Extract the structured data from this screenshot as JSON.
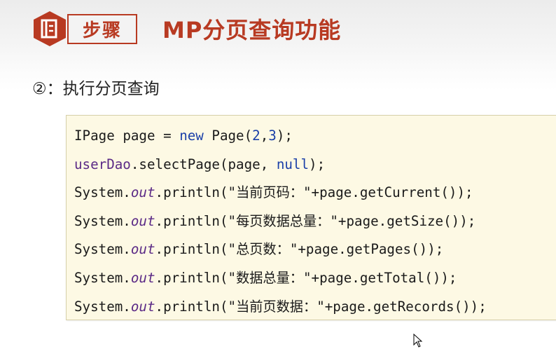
{
  "header": {
    "step_label": "步骤",
    "title": "MP分页查询功能"
  },
  "section": {
    "subtitle": "②：执行分页查询"
  },
  "code": {
    "line1": {
      "type": "IPage",
      "var": " page = ",
      "kw": "new",
      "ctor": " Page(",
      "n1": "2",
      "comma": ",",
      "n2": "3",
      "end": ");"
    },
    "line2": {
      "obj": "userDao",
      "rest": ".selectPage(page, ",
      "kw": "null",
      "end": ");"
    },
    "line3": {
      "sys": "System.",
      "out": "out",
      "call": ".println(\"",
      "str": "当前页码：",
      "rest": "\"+page.getCurrent());"
    },
    "line4": {
      "sys": "System.",
      "out": "out",
      "call": ".println(\"",
      "str": "每页数据总量：",
      "rest": "\"+page.getSize());"
    },
    "line5": {
      "sys": "System.",
      "out": "out",
      "call": ".println(\"",
      "str": "总页数：",
      "rest": "\"+page.getPages());"
    },
    "line6": {
      "sys": "System.",
      "out": "out",
      "call": ".println(\"",
      "str": "数据总量：",
      "rest": "\"+page.getTotal());"
    },
    "line7": {
      "sys": "System.",
      "out": "out",
      "call": ".println(\"",
      "str": "当前页数据：",
      "rest": "\"+page.getRecords());"
    }
  },
  "colors": {
    "accent": "#b83a22",
    "keyword": "#1a3fa8",
    "field": "#5b2a86",
    "code_bg": "#fdf9e4"
  }
}
